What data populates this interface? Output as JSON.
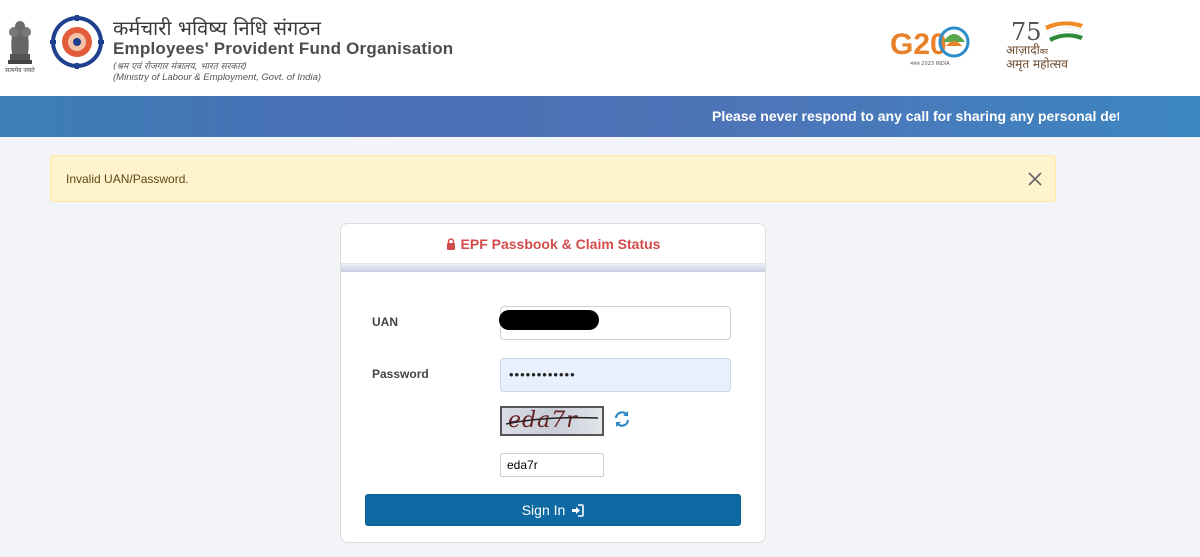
{
  "header": {
    "emblem_caption": "सत्यमेव जयते",
    "org_name_hindi": "कर्मचारी भविष्य निधि संगठन",
    "org_name_english": "Employees' Provident Fund Organisation",
    "org_sub_hindi": "(श्रम एवं रोजगार मंत्रालय, भारत सरकार)",
    "org_sub_english": "(Ministry of Labour & Employment, Govt. of India)",
    "g20_label": "G20",
    "g20_tagline": "भारत 2023 INDIA",
    "azadi_line1": "आज़ादी",
    "azadi_ka": "का",
    "azadi_line2": "अमृत महोत्सव",
    "azadi_number": "75"
  },
  "notice": {
    "text": "Please never respond to any call for sharing any personal details"
  },
  "alert": {
    "message": "Invalid UAN/Password."
  },
  "login": {
    "title": "EPF Passbook & Claim Status",
    "uan_label": "UAN",
    "uan_value": "",
    "password_label": "Password",
    "password_value": "••••••••••••",
    "captcha_text": "eda7r",
    "captcha_input_value": "eda7r",
    "signin_label": "Sign In"
  },
  "colors": {
    "notice_bar": "#4b6fb5",
    "alert_bg": "#fff3cd",
    "title_red": "#d24b4b",
    "button_blue": "#0f6aa3"
  },
  "icons": {
    "lock": "lock-icon",
    "close": "close-icon",
    "refresh": "refresh-icon",
    "signin": "sign-in-icon"
  }
}
